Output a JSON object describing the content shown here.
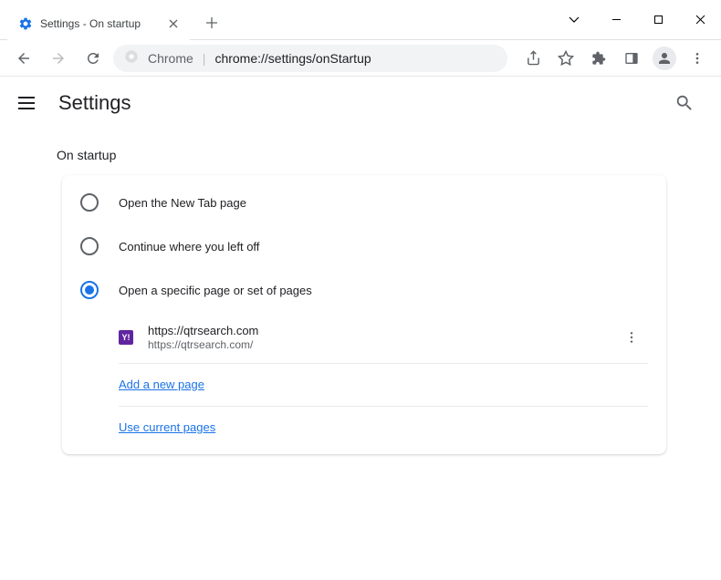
{
  "window": {
    "tab_title": "Settings - On startup",
    "tab_icon": "gear-icon"
  },
  "address": {
    "prefix": "Chrome",
    "url": "chrome://settings/onStartup"
  },
  "header": {
    "title": "Settings"
  },
  "section": {
    "title": "On startup",
    "options": [
      {
        "label": "Open the New Tab page",
        "selected": false
      },
      {
        "label": "Continue where you left off",
        "selected": false
      },
      {
        "label": "Open a specific page or set of pages",
        "selected": true
      }
    ],
    "pages": [
      {
        "title": "https://qtrsearch.com",
        "url": "https://qtrsearch.com/"
      }
    ],
    "actions": {
      "add_page": "Add a new page",
      "use_current": "Use current pages"
    }
  },
  "colors": {
    "accent": "#1a73e8",
    "text_primary": "#202124",
    "text_secondary": "#5f6368"
  }
}
